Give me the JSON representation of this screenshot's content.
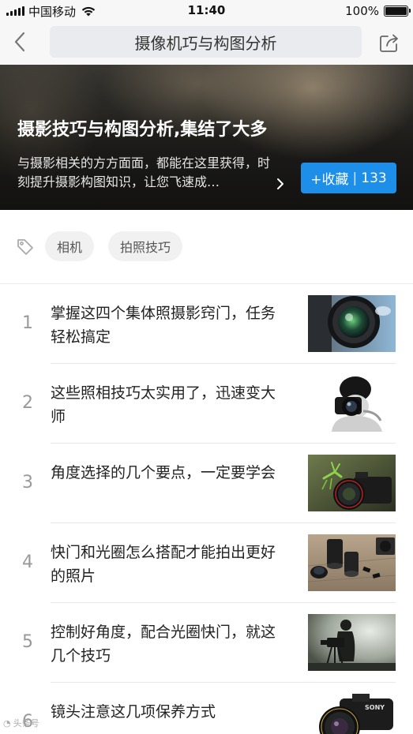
{
  "status_bar": {
    "carrier": "中国移动",
    "time": "11:40",
    "battery": "100%"
  },
  "nav": {
    "title": "摄像机巧与构图分析",
    "back_icon": "chevron-left-icon",
    "share_icon": "share-icon"
  },
  "hero": {
    "title": "摄影技巧与构图分析,集结了大多",
    "description": "与摄影相关的方方面面，都能在这里获得，时刻提升摄影构图知识，让您飞速成…",
    "collect_label": "+收藏",
    "separator": "|",
    "collect_count": "133"
  },
  "tags": [
    "相机",
    "拍照技巧"
  ],
  "articles": [
    {
      "num": "1",
      "title": "掌握这四个集体照摄影窍门，任务轻松搞定",
      "thumb": "camera-lens"
    },
    {
      "num": "2",
      "title": "这些照相技巧太实用了，迅速变大师",
      "thumb": "photographer-bw"
    },
    {
      "num": "3",
      "title": "角度选择的几个要点，一定要学会",
      "thumb": "mantis-camera"
    },
    {
      "num": "4",
      "title": "快门和光圈怎么搭配才能拍出更好的照片",
      "thumb": "lenses-on-table"
    },
    {
      "num": "5",
      "title": "控制好角度，配合光圈快门，就这几个技巧",
      "thumb": "silhouette-cameraman"
    },
    {
      "num": "6",
      "title": "镜头注意这几项保养方式",
      "thumb": "sony-camera"
    }
  ],
  "watermark": "头条号"
}
